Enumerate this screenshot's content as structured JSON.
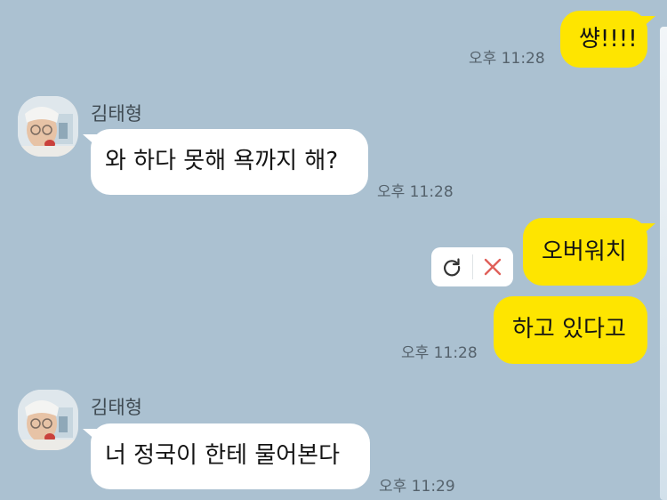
{
  "messages": [
    {
      "id": "m1",
      "side": "mine",
      "text": "썅!!!!",
      "time": "오후 11:28"
    },
    {
      "id": "m2",
      "side": "theirs",
      "sender": "김태형",
      "text": "와 하다 못해 욕까지 해?",
      "time": "오후 11:28"
    },
    {
      "id": "m3",
      "side": "mine",
      "text": "오버워치",
      "status": "failed",
      "retry_icon": "retry-icon",
      "delete_icon": "delete-icon"
    },
    {
      "id": "m4",
      "side": "mine",
      "text": "하고 있다고",
      "time": "오후 11:28"
    },
    {
      "id": "m5",
      "side": "theirs",
      "sender": "김태형",
      "text": "너 정국이 한테 물어본다",
      "time": "오후 11:29"
    }
  ],
  "colors": {
    "background": "#abc1d1",
    "my_bubble": "#fee500",
    "their_bubble": "#ffffff",
    "delete_x": "#e0605a"
  }
}
